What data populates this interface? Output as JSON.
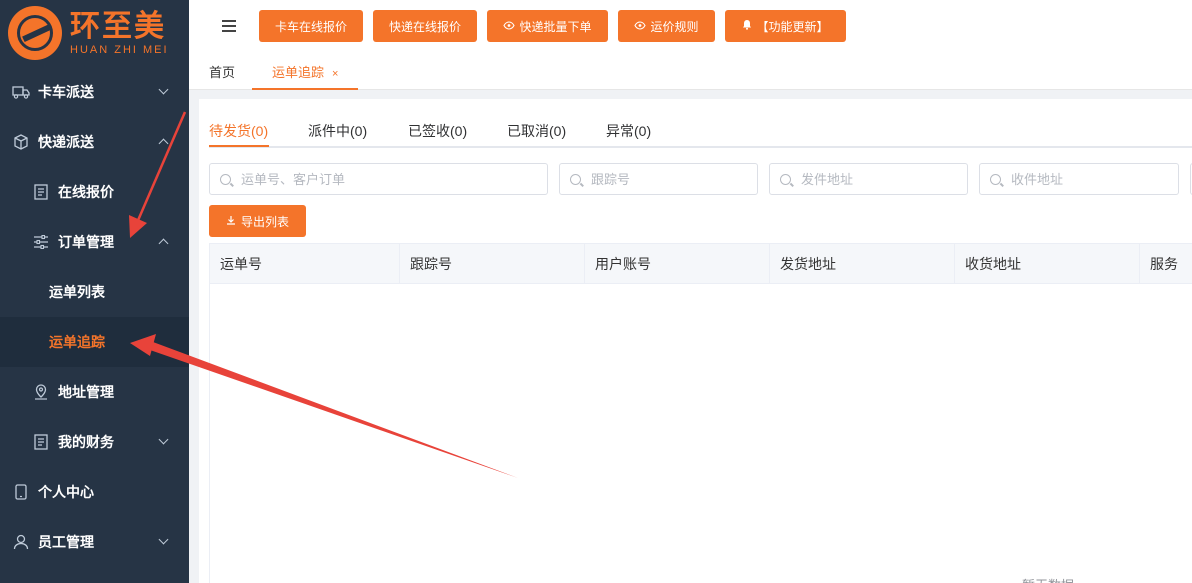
{
  "brand": {
    "name_cn": "环至美",
    "name_en": "HUAN ZHI MEI",
    "accent": "#f4742a"
  },
  "sidebar": {
    "items": [
      {
        "label": "卡车派送",
        "icon": "truck-icon",
        "expanded": false
      },
      {
        "label": "快递派送",
        "icon": "package-icon",
        "expanded": true
      },
      {
        "label": "在线报价",
        "icon": "document-icon"
      },
      {
        "label": "订单管理",
        "icon": "sliders-icon",
        "expanded": true
      },
      {
        "label": "运单列表"
      },
      {
        "label": "运单追踪",
        "active": true
      },
      {
        "label": "地址管理",
        "icon": "location-icon"
      },
      {
        "label": "我的财务",
        "icon": "document-icon",
        "expanded": false
      },
      {
        "label": "个人中心",
        "icon": "phone-icon"
      },
      {
        "label": "员工管理",
        "icon": "user-icon",
        "expanded": false
      }
    ]
  },
  "toolbar": {
    "buttons": [
      {
        "label": "卡车在线报价"
      },
      {
        "label": "快递在线报价"
      },
      {
        "label": "快递批量下单",
        "icon": "eye-icon"
      },
      {
        "label": "运价规则",
        "icon": "eye-icon"
      },
      {
        "label": "【功能更新】",
        "icon": "bell-icon"
      }
    ]
  },
  "page_tabs": [
    {
      "label": "首页"
    },
    {
      "label": "运单追踪",
      "active": true,
      "close": "×"
    }
  ],
  "status_tabs": [
    {
      "label": "待发货(0)",
      "active": true
    },
    {
      "label": "派件中(0)"
    },
    {
      "label": "已签收(0)"
    },
    {
      "label": "已取消(0)"
    },
    {
      "label": "异常(0)"
    }
  ],
  "filters": {
    "waybill_placeholder": "运单号、客户订单",
    "tracking_placeholder": "跟踪号",
    "sender_placeholder": "发件地址",
    "receiver_placeholder": "收件地址"
  },
  "export_label": "导出列表",
  "table": {
    "columns": [
      "运单号",
      "跟踪号",
      "用户账号",
      "发货地址",
      "收货地址",
      "服务"
    ],
    "empty_text": "暂无数据"
  }
}
